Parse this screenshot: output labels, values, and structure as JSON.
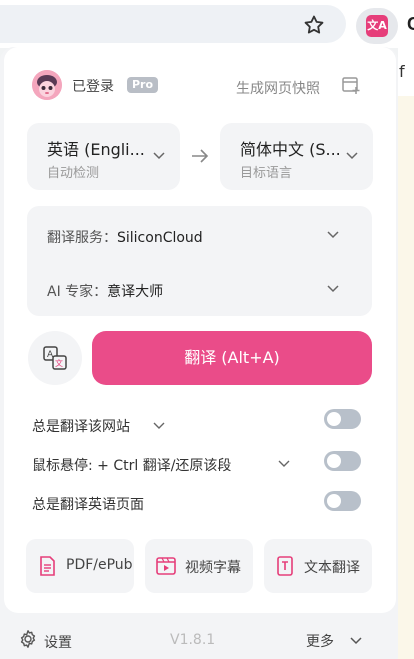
{
  "login": {
    "status": "已登录",
    "badge": "Pro"
  },
  "snapshot": {
    "label": "生成网页快照"
  },
  "source_lang": {
    "name": "英语 (Engli...",
    "sub": "自动检测"
  },
  "target_lang": {
    "name": "简体中文 (S...",
    "sub": "目标语言"
  },
  "service": {
    "label": "翻译服务：",
    "value": "SiliconCloud"
  },
  "ai_expert": {
    "label": "AI 专家：",
    "value": "意译大师"
  },
  "translate_button": {
    "label": "翻译 (Alt+A)"
  },
  "options": [
    {
      "label": "总是翻译该网站",
      "enabled": false
    },
    {
      "label": "鼠标悬停:  + Ctrl 翻译/还原该段",
      "enabled": false
    },
    {
      "label": "总是翻译英语页面",
      "enabled": false
    }
  ],
  "tools": [
    {
      "label": "PDF/ePub",
      "icon": "pdf-file-icon"
    },
    {
      "label": "视频字幕",
      "icon": "video-subtitle-icon"
    },
    {
      "label": "文本翻译",
      "icon": "text-translate-icon"
    }
  ],
  "footer": {
    "settings": "设置",
    "version": "V1.8.1",
    "more": "更多"
  },
  "colors": {
    "accent": "#ea4c89",
    "toggle_off": "#b8c0ca",
    "panel_bg": "#f3f4f6"
  },
  "chrome": {
    "star_icon": "bookmark-star-icon",
    "extension_icon": "immersive-translate-icon"
  }
}
